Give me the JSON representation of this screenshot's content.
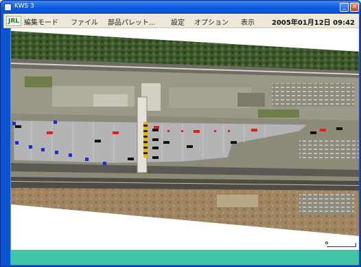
{
  "window": {
    "title": "KWS 3",
    "minimize_glyph": "_",
    "close_glyph": "×"
  },
  "menu": {
    "logo_text": "JRL",
    "items": [
      "編集モード",
      "ファイル",
      "部品パレット...",
      "設定",
      "オプション",
      "表示"
    ],
    "datetime": "2005年01月12日 09:42"
  },
  "map": {
    "colors": {
      "parking_lot": "#b4b4b4",
      "vehicle_black": "#111111",
      "vehicle_red": "#e02020",
      "vehicle_blue": "#1a2fd6",
      "barrier_yellow": "#e8b400",
      "bottom_band": "#43c4a4"
    },
    "icons": [
      "scale-bar-icon"
    ]
  }
}
